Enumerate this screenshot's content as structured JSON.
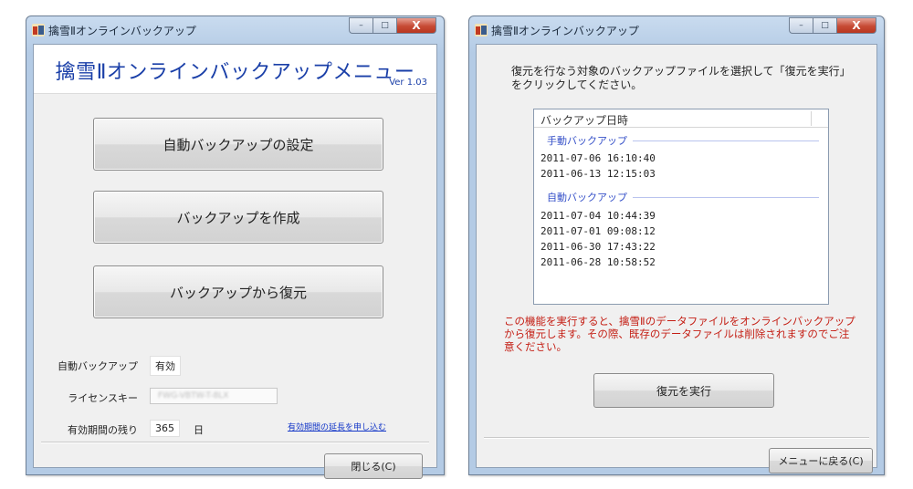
{
  "backup_menu_window": {
    "title": "擒雪Ⅱオンラインバックアップ",
    "banner_title": "擒雪Ⅱオンラインバックアップメニュー",
    "version": "Ver 1.03",
    "buttons": {
      "auto_settings": "自動バックアップの設定",
      "create_backup": "バックアップを作成",
      "restore_backup": "バックアップから復元",
      "close": "閉じる(C)"
    },
    "info": {
      "auto_backup_label": "自動バックアップ",
      "auto_backup_value": "有効",
      "license_label": "ライセンスキー",
      "license_value": "FWG-VBTW-T-8LX",
      "remaining_label": "有効期間の残り",
      "remaining_value": "365",
      "remaining_unit": "日",
      "extend_link": "有効期間の延長を申し込む"
    }
  },
  "restore_window": {
    "title": "擒雪Ⅱオンラインバックアップ",
    "instruction": "復元を行なう対象のバックアップファイルを選択して「復元を実行」をクリックしてください。",
    "list": {
      "column_header": "バックアップ日時",
      "groups": [
        {
          "label": "手動バックアップ",
          "items": [
            "2011-07-06 16:10:40",
            "2011-06-13 12:15:03"
          ]
        },
        {
          "label": "自動バックアップ",
          "items": [
            "2011-07-04 10:44:39",
            "2011-07-01 09:08:12",
            "2011-06-30 17:43:22",
            "2011-06-28 10:58:52"
          ]
        }
      ]
    },
    "warning": "この機能を実行すると、擒雪Ⅱのデータファイルをオンラインバックアップから復元します。その際、既存のデータファイルは削除されますのでご注意ください。",
    "buttons": {
      "execute_restore": "復元を実行",
      "back_to_menu": "メニューに戻る(C)"
    }
  },
  "window_controls": {
    "minimize": "–",
    "maximize": "□",
    "close": "X"
  },
  "colors": {
    "title_blue": "#1a3fa8",
    "link_blue": "#1538c8",
    "group_blue": "#3550c8",
    "warning_red": "#c41e14",
    "frame_blue": "#b4cbe5"
  },
  "icons": {
    "app": "app-logo-icon"
  }
}
